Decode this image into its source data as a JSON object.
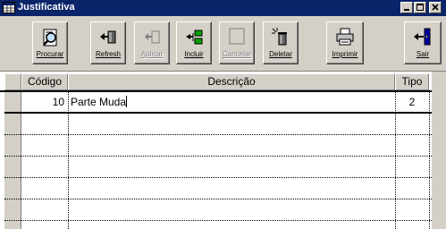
{
  "window": {
    "title": "Justificativa"
  },
  "toolbar": {
    "buttons": [
      {
        "label": "Procurar",
        "icon": "search-icon",
        "enabled": true
      },
      {
        "label": "Refresh",
        "icon": "refresh-icon",
        "enabled": true
      },
      {
        "label": "Aplicar",
        "icon": "apply-icon",
        "enabled": false
      },
      {
        "label": "Incluir",
        "icon": "include-icon",
        "enabled": true
      },
      {
        "label": "Cancelar",
        "icon": "cancel-icon",
        "enabled": false
      },
      {
        "label": "Deletar",
        "icon": "delete-icon",
        "enabled": true
      },
      {
        "label": "Imprimir",
        "icon": "printer-icon",
        "enabled": true
      },
      {
        "label": "Sair",
        "icon": "exit-icon",
        "enabled": true
      }
    ]
  },
  "grid": {
    "columns": [
      "Código",
      "Descrição",
      "Tipo"
    ],
    "rows": [
      {
        "codigo": "10",
        "descricao": "Parte Muda",
        "tipo": "2"
      }
    ]
  },
  "colors": {
    "titlebar": "#0a246a",
    "face": "#d4d0c8"
  }
}
